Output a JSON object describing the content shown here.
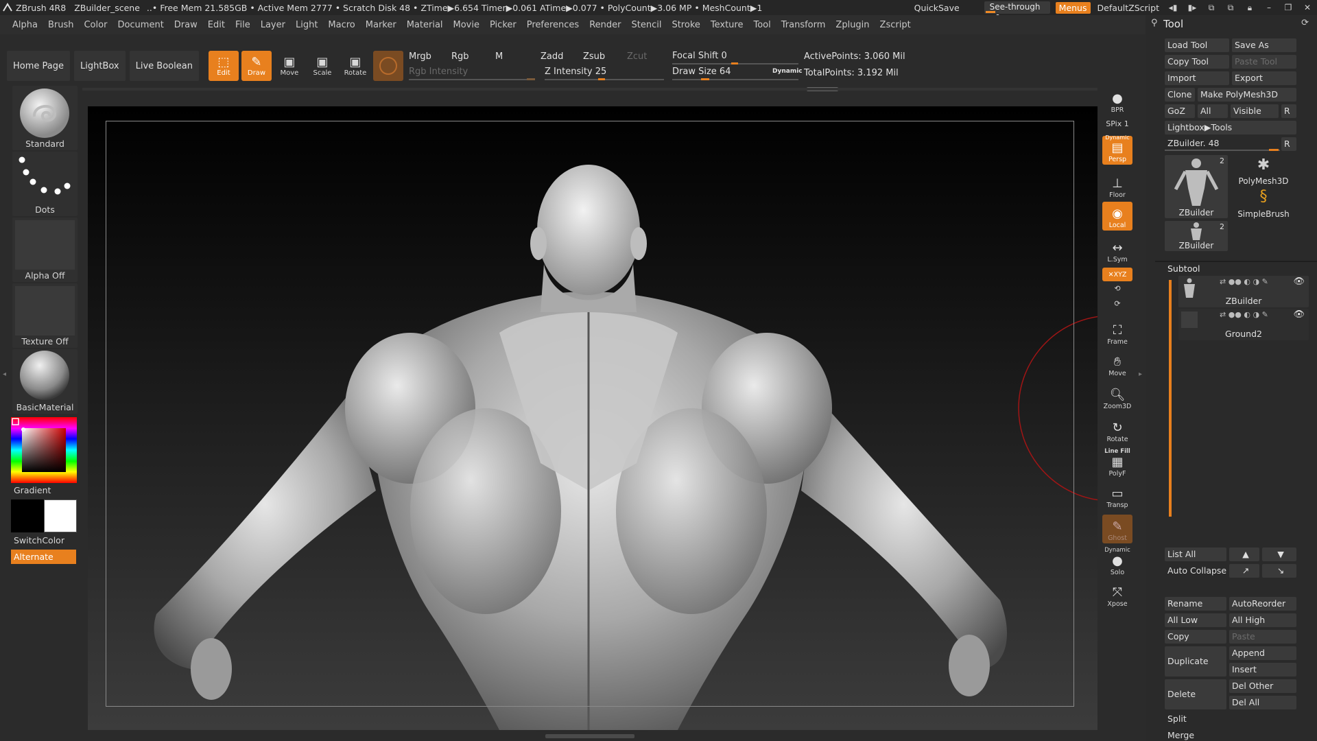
{
  "titlebar": {
    "app": "ZBrush 4R8",
    "scene": "ZBuilder_scene",
    "stats": "..• Free Mem 21.585GB • Active Mem 2777 • Scratch Disk 48 • ZTime▶6.654 Timer▶0.061 ATime▶0.077 • PolyCount▶3.06 MP • MeshCount▶1",
    "quicksave": "QuickSave",
    "see_through_label": "See-through",
    "see_through_value": "0",
    "menus": "Menus",
    "script": "DefaultZScript"
  },
  "menubar": [
    "Alpha",
    "Brush",
    "Color",
    "Document",
    "Draw",
    "Edit",
    "File",
    "Layer",
    "Light",
    "Macro",
    "Marker",
    "Material",
    "Movie",
    "Picker",
    "Preferences",
    "Render",
    "Stencil",
    "Stroke",
    "Texture",
    "Tool",
    "Transform",
    "Zplugin",
    "Zscript"
  ],
  "shelf": {
    "tabs": [
      "Home Page",
      "LightBox",
      "Live Boolean"
    ],
    "tools": [
      {
        "label": "Edit",
        "icon": "edit-icon",
        "active": true
      },
      {
        "label": "Draw",
        "icon": "draw-icon",
        "active": true
      },
      {
        "label": "Move",
        "icon": "move-icon",
        "active": false
      },
      {
        "label": "Scale",
        "icon": "scale-icon",
        "active": false
      },
      {
        "label": "Rotate",
        "icon": "rotate-icon",
        "active": false
      }
    ],
    "mrgb": "Mrgb",
    "rgb": "Rgb",
    "m": "M",
    "rgb_intensity": "Rgb Intensity",
    "zadd": "Zadd",
    "zsub": "Zsub",
    "zcut": "Zcut",
    "z_intensity_label": "Z Intensity",
    "z_intensity_value": "25",
    "focal_shift_label": "Focal Shift",
    "focal_shift_value": "0",
    "draw_size_label": "Draw Size",
    "draw_size_value": "64",
    "dynamic": "Dynamic",
    "active_points": "ActivePoints: 3.060 Mil",
    "total_points": "TotalPoints: 3.192 Mil"
  },
  "left": {
    "brush": "Standard",
    "stroke": "Dots",
    "alpha": "Alpha Off",
    "texture": "Texture Off",
    "material": "BasicMaterial",
    "gradient": "Gradient",
    "switchcolor": "SwitchColor",
    "alternate": "Alternate"
  },
  "dock": {
    "bpr": "BPR",
    "spix": "SPix 1",
    "persp": "Persp",
    "persp_top": "Dynamic",
    "floor": "Floor",
    "local": "Local",
    "lsym": "L.Sym",
    "xyz": "✕XYZ",
    "frame": "Frame",
    "move": "Move",
    "zoom3d": "Zoom3D",
    "rotate": "Rotate",
    "linefill": "Line Fill",
    "polyf": "PolyF",
    "transp": "Transp",
    "ghost": "Ghost",
    "solo_top": "Dynamic",
    "solo": "Solo",
    "xpose": "Xpose"
  },
  "toolpanel": {
    "title": "Tool",
    "load_tool": "Load Tool",
    "save_as": "Save As",
    "copy_tool": "Copy Tool",
    "paste_tool": "Paste Tool",
    "import": "Import",
    "export": "Export",
    "clone": "Clone",
    "make_polymesh": "Make PolyMesh3D",
    "goz": "GoZ",
    "all": "All",
    "visible": "Visible",
    "r": "R",
    "lightbox_tools": "Lightbox▶Tools",
    "current_tool": "ZBuilder. 48",
    "thumbs": [
      {
        "label": "ZBuilder",
        "count": "2"
      },
      {
        "label": "PolyMesh3D",
        "count": ""
      },
      {
        "label": "SimpleBrush",
        "count": ""
      },
      {
        "label": "ZBuilder",
        "count": "2"
      }
    ],
    "subtool_header": "Subtool",
    "subtools": [
      "ZBuilder",
      "Ground2"
    ],
    "list_all": "List All",
    "auto_collapse": "Auto Collapse",
    "rename": "Rename",
    "autoreorder": "AutoReorder",
    "all_low": "All Low",
    "all_high": "All High",
    "copy": "Copy",
    "paste": "Paste",
    "duplicate": "Duplicate",
    "append": "Append",
    "insert": "Insert",
    "delete": "Delete",
    "del_other": "Del Other",
    "del_all": "Del All",
    "split": "Split",
    "merge": "Merge"
  },
  "colors": {
    "accent": "#e8801e",
    "panel": "#2a2a2a",
    "viewport": "#000000"
  }
}
